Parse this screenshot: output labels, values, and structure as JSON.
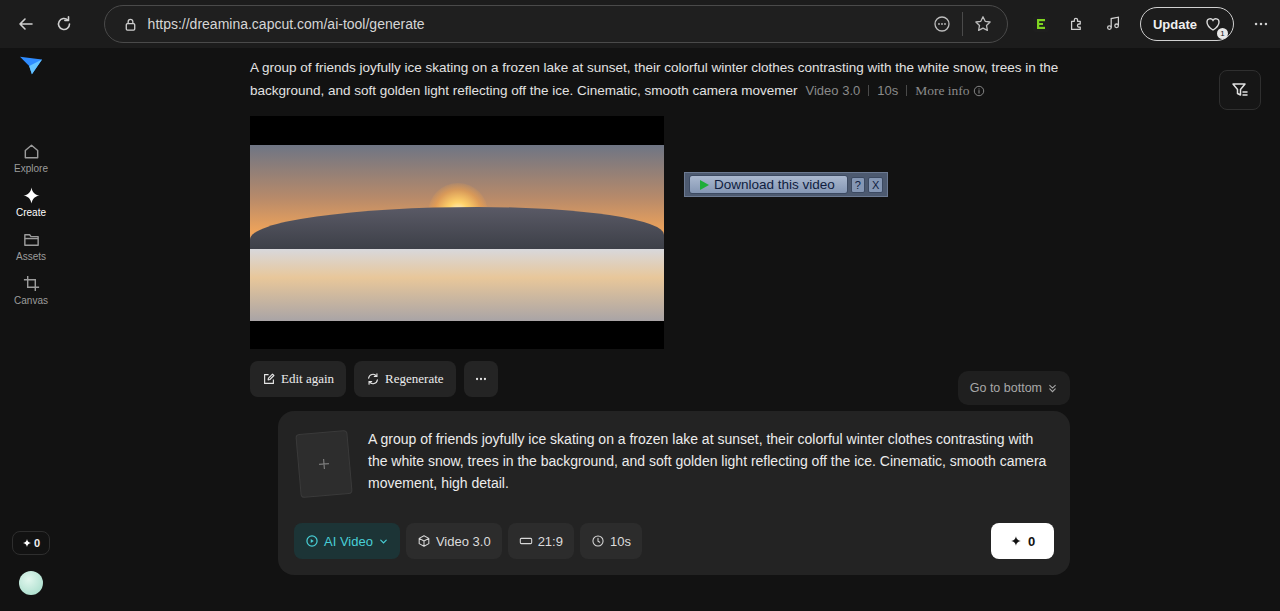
{
  "browser": {
    "url": "https://dreamina.capcut.com/ai-tool/generate",
    "update_label": "Update",
    "update_badge": "1"
  },
  "sidebar": {
    "items": [
      {
        "label": "Explore",
        "kind": "home",
        "selected": false
      },
      {
        "label": "Create",
        "kind": "create",
        "selected": true
      },
      {
        "label": "Assets",
        "kind": "folder",
        "selected": false
      },
      {
        "label": "Canvas",
        "kind": "canvas",
        "selected": false
      }
    ],
    "credits": "0"
  },
  "result": {
    "prompt": "A group of friends joyfully ice skating on a frozen lake at sunset, their colorful winter clothes contrasting with the white snow, trees in the background, and soft golden light reflecting off the ice. Cinematic, smooth camera movemer",
    "model": "Video 3.0",
    "duration": "10s",
    "more_info": "More info",
    "actions": [
      {
        "label": "Edit again",
        "kind": "edit"
      },
      {
        "label": "Regenerate",
        "kind": "regenerate"
      }
    ],
    "go_to_bottom": "Go to bottom"
  },
  "download_overlay": {
    "label": "Download this video",
    "help": "?",
    "close": "X"
  },
  "composer": {
    "prompt": "A group of friends joyfully ice skating on a frozen lake at sunset, their colorful winter clothes contrasting with the white snow, trees in the background, and soft golden light reflecting off the ice. Cinematic, smooth camera movement, high detail.",
    "mode": "AI Video",
    "model": "Video 3.0",
    "ratio": "21:9",
    "duration": "10s",
    "generate_cost": "0"
  }
}
